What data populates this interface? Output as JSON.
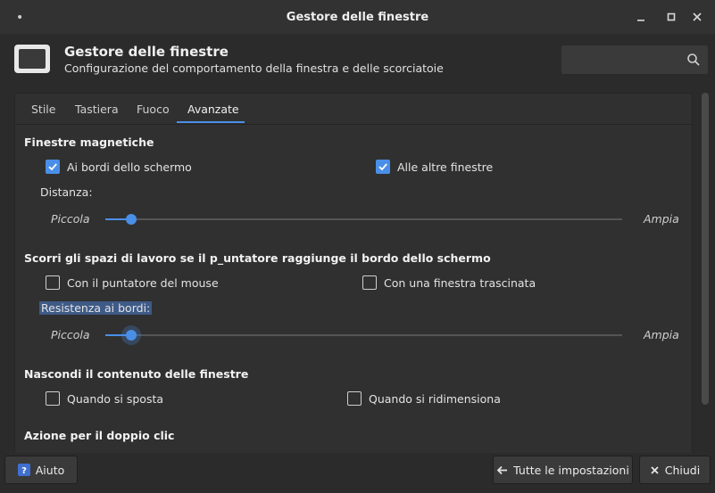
{
  "window": {
    "title": "Gestore delle finestre",
    "menu_icon": "dot-icon"
  },
  "header": {
    "title": "Gestore delle finestre",
    "subtitle": "Configurazione del comportamento della finestra e delle scorciatoie",
    "search": {
      "value": "",
      "placeholder": ""
    }
  },
  "tabs": [
    {
      "label": "Stile",
      "active": false
    },
    {
      "label": "Tastiera",
      "active": false
    },
    {
      "label": "Fuoco",
      "active": false
    },
    {
      "label": "Avanzate",
      "active": true
    }
  ],
  "sections": {
    "magnetic": {
      "title": "Finestre magnetiche",
      "opt_screen_edges": {
        "label": "Ai bordi dello schermo",
        "checked": true
      },
      "opt_other_windows": {
        "label": "Alle altre finestre",
        "checked": true
      },
      "distance_label": "Distanza:",
      "distance_slider": {
        "left": "Piccola",
        "right": "Ampia",
        "value": 0.05
      }
    },
    "workspaces": {
      "title": "Scorri gli spazi di lavoro se il p_untatore raggiunge il bordo dello schermo",
      "opt_mouse_pointer": {
        "label": "Con il puntatore del mouse",
        "checked": false
      },
      "opt_dragged_window": {
        "label": "Con una finestra trascinata",
        "checked": false
      },
      "resistance_label": "Resistenza ai bordi:",
      "resistance_slider": {
        "left": "Piccola",
        "right": "Ampia",
        "value": 0.05
      }
    },
    "hide_content": {
      "title": "Nascondi il contenuto delle finestre",
      "opt_moving": {
        "label": "Quando si sposta",
        "checked": false
      },
      "opt_resizing": {
        "label": "Quando si ridimensiona",
        "checked": false
      }
    },
    "double_click": {
      "title": "Azione per il doppio clic"
    }
  },
  "footer": {
    "help": "Aiuto",
    "all_settings": "Tutte le impostazioni",
    "close": "Chiudi"
  },
  "colors": {
    "accent": "#4a8fe7",
    "background": "#2b2b2b",
    "panel": "#303030"
  }
}
